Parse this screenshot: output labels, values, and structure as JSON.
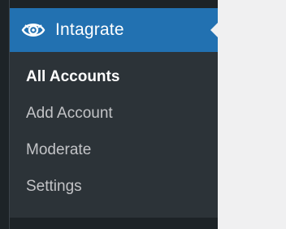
{
  "menu": {
    "title": "Intagrate",
    "icon": "intagrate-eye-icon"
  },
  "submenu": {
    "items": [
      {
        "label": "All Accounts",
        "current": true
      },
      {
        "label": "Add Account",
        "current": false
      },
      {
        "label": "Moderate",
        "current": false
      },
      {
        "label": "Settings",
        "current": false
      }
    ]
  },
  "colors": {
    "sidebar_bg": "#1d2327",
    "submenu_bg": "#2c3338",
    "active_bg": "#2271b1",
    "content_bg": "#f0f0f1",
    "submenu_text": "#c3c4c7",
    "current_text": "#ffffff"
  }
}
